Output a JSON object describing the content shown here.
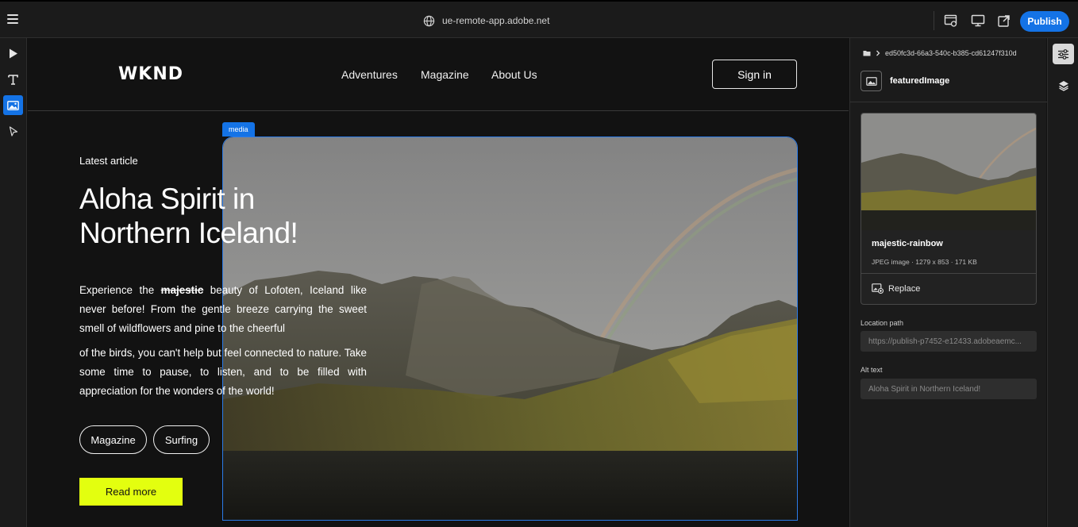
{
  "topbar": {
    "url": "ue-remote-app.adobe.net",
    "publish_label": "Publish"
  },
  "icons": {
    "menu": "hamburger-menu-icon",
    "globe": "globe-icon",
    "preview_settings": "preview-settings-icon",
    "desktop": "desktop-icon",
    "open_external": "open-external-icon",
    "play": "play-icon",
    "text": "text-icon",
    "image": "image-icon",
    "pointer": "pointer-icon",
    "properties": "properties-icon",
    "layers": "layers-icon"
  },
  "site": {
    "logo": "WKND",
    "nav": [
      "Adventures",
      "Magazine",
      "About Us"
    ],
    "signin_label": "Sign in",
    "media_tag": "media",
    "latest": "Latest article",
    "headline": "Aloha Spirit in Northern Iceland!",
    "para1_before": "Experience the ",
    "para1_strike": "majestic",
    "para1_after": " beauty of Lofoten, Iceland like never before! From the gentle breeze carrying the sweet smell of wildflowers and pine to the cheerful",
    "para2": "of the birds, you can't help but feel connected to nature. Take some time to pause, to listen, and to be filled with appreciation for the wonders of the world!",
    "tags": [
      "Magazine",
      "Surfing"
    ],
    "read_more": "Read more"
  },
  "panel": {
    "breadcrumb": "ed50fc3d-66a3-540c-b385-cd61247f310d",
    "component_name": "featuredImage",
    "asset_name": "majestic-rainbow",
    "asset_meta": "JPEG image  · 1279 x 853  · 171 KB",
    "replace_label": "Replace",
    "location_label": "Location path",
    "location_value": "https://publish-p7452-e12433.adobeaemc...",
    "alt_label": "Alt text",
    "alt_value": "Aloha Spirit in Northern Iceland!"
  },
  "colors": {
    "accent": "#1473e6",
    "cta": "#e3ff0f",
    "background": "#121212"
  }
}
